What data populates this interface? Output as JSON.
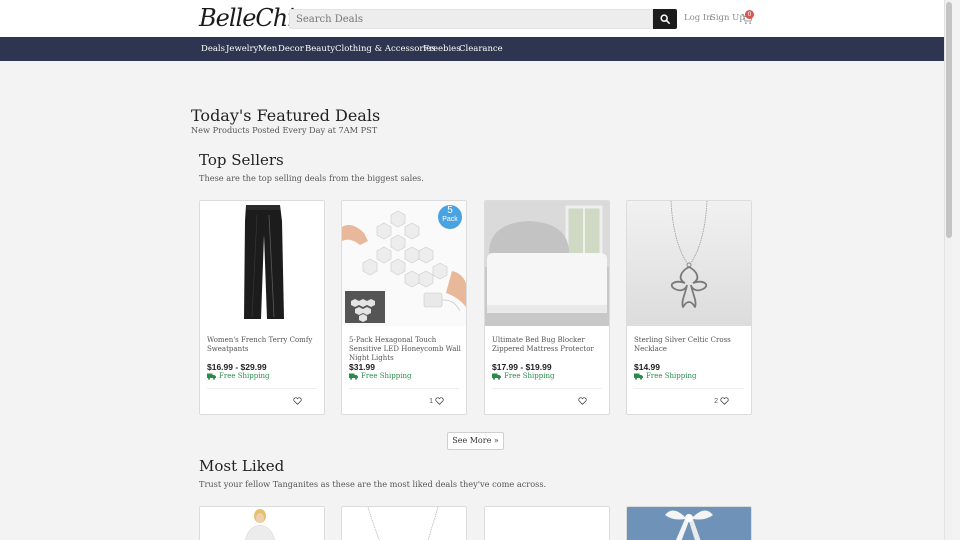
{
  "header": {
    "logo": "BelleChic",
    "search": {
      "placeholder": "Search Deals",
      "value": ""
    },
    "login_label": "Log In",
    "signup_label": "Sign Up",
    "cart_count": "0"
  },
  "nav": {
    "items": [
      {
        "label": "Deals"
      },
      {
        "label": "Jewelry"
      },
      {
        "label": "Men"
      },
      {
        "label": "Decor"
      },
      {
        "label": "Beauty"
      },
      {
        "label": "Clothing & Accessories"
      },
      {
        "label": "Freebies"
      },
      {
        "label": "Clearance"
      }
    ]
  },
  "featured": {
    "title": "Today's Featured Deals",
    "subtitle": "New Products Posted Every Day at 7AM PST"
  },
  "top_sellers": {
    "title": "Top Sellers",
    "subtitle": "These are the top selling deals from the biggest sales.",
    "products": [
      {
        "name": "Women's French Terry Comfy Sweatpants",
        "price": "$16.99 - $29.99",
        "shipping": "Free Shipping",
        "likes": "",
        "image": "black-sweatpants"
      },
      {
        "name": "5-Pack Hexagonal Touch Sensitive LED Honeycomb Wall Night Lights",
        "price": "$31.99",
        "shipping": "Free Shipping",
        "likes": "1",
        "image": "hexagon-lights",
        "badge_number": "5",
        "badge_text": "Pack"
      },
      {
        "name": "Ultimate Bed Bug Blocker Zippered Mattress Protector",
        "price": "$17.99 - $19.99",
        "shipping": "Free Shipping",
        "likes": "",
        "image": "mattress-protector"
      },
      {
        "name": "Sterling Silver Celtic Cross Necklace",
        "price": "$14.99",
        "shipping": "Free Shipping",
        "likes": "2",
        "image": "cross-necklace"
      }
    ],
    "see_more_label": "See More »"
  },
  "most_liked": {
    "title": "Most Liked",
    "subtitle": "Trust your fellow Tanganites as these are the most liked deals they've come across."
  },
  "colors": {
    "navbar": "#2e3550",
    "free_shipping": "#2a8c4a",
    "cart_badge": "#d9534f",
    "pack_badge": "#4aa3e0"
  }
}
